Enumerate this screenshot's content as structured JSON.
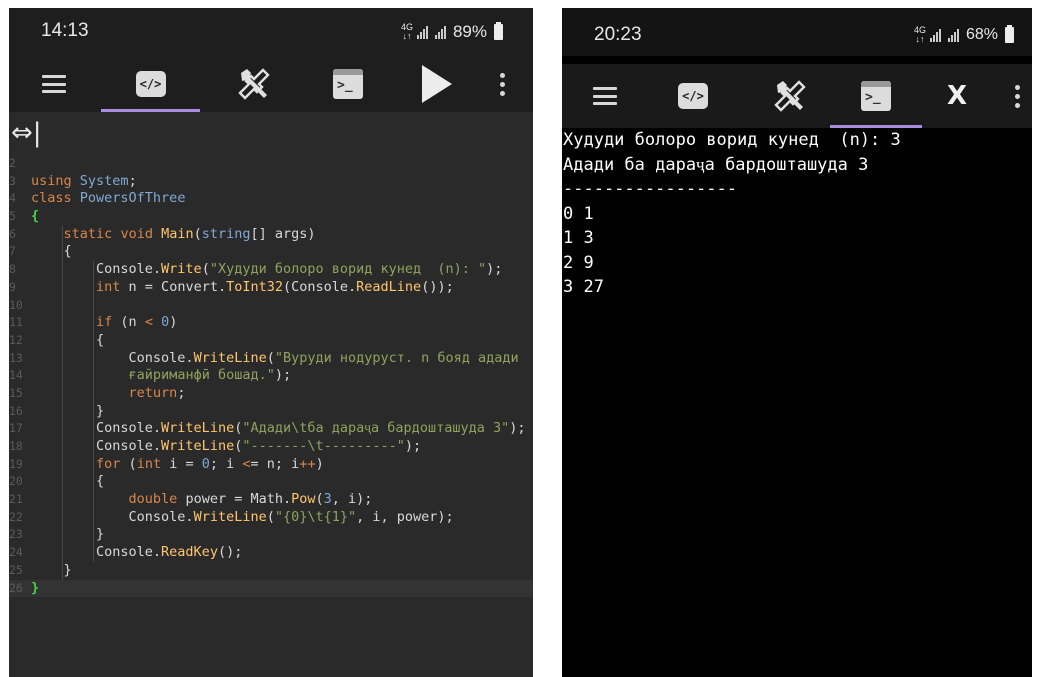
{
  "left": {
    "status": {
      "time": "14:13",
      "network": "4G",
      "battery": "89%"
    },
    "toolbar": {
      "code_icon": "</>"
    },
    "editor": {
      "wrap_icon": "⇔|",
      "lines": [
        {
          "n": "2",
          "t": ""
        },
        {
          "n": "3",
          "t": "using System;"
        },
        {
          "n": "4",
          "t": "class PowersOfThree"
        },
        {
          "n": "5",
          "t": "{"
        },
        {
          "n": "6",
          "t": "    static void Main(string[] args)"
        },
        {
          "n": "7",
          "t": "    {"
        },
        {
          "n": "8",
          "t": "        Console.Write(\"Худуди болоро ворид кунед  (n): \");"
        },
        {
          "n": "9",
          "t": "        int n = Convert.ToInt32(Console.ReadLine());"
        },
        {
          "n": "10",
          "t": ""
        },
        {
          "n": "11",
          "t": "        if (n < 0)"
        },
        {
          "n": "12",
          "t": "        {"
        },
        {
          "n": "13",
          "t": "            Console.WriteLine(\"Вуруди нодуруст. n бояд адади"
        },
        {
          "n": "14",
          "t": "            ғайриманфӣ бошад.\");"
        },
        {
          "n": "15",
          "t": "            return;"
        },
        {
          "n": "16",
          "t": "        }"
        },
        {
          "n": "17",
          "t": "        Console.WriteLine(\"Адади\\tба дараҷа бардошташуда 3\");"
        },
        {
          "n": "18",
          "t": "        Console.WriteLine(\"-------\\t---------\");"
        },
        {
          "n": "19",
          "t": "        for (int i = 0; i <= n; i++)"
        },
        {
          "n": "20",
          "t": "        {"
        },
        {
          "n": "21",
          "t": "            double power = Math.Pow(3, i);"
        },
        {
          "n": "22",
          "t": "            Console.WriteLine(\"{0}\\t{1}\", i, power);"
        },
        {
          "n": "23",
          "t": "        }"
        },
        {
          "n": "24",
          "t": "        Console.ReadKey();"
        },
        {
          "n": "25",
          "t": "    }"
        },
        {
          "n": "26",
          "t": "}"
        }
      ]
    }
  },
  "right": {
    "status": {
      "time": "20:23",
      "network": "4G",
      "battery": "68%"
    },
    "toolbar": {
      "code_icon": "</>",
      "close_label": "X"
    },
    "console": {
      "lines": [
        "Худуди болоро ворид кунед  (n): 3",
        "Адади ба дараҷа бардошташуда 3",
        "-----------------",
        "0 1",
        "1 3",
        "2 9",
        "3 27"
      ]
    }
  },
  "colors": {
    "keyword": "#d9864a",
    "type": "#7fa9d4",
    "string": "#8fa35e",
    "method": "#ffc66d",
    "accent_underline": "#a98ce0",
    "brace": "#44d544"
  }
}
